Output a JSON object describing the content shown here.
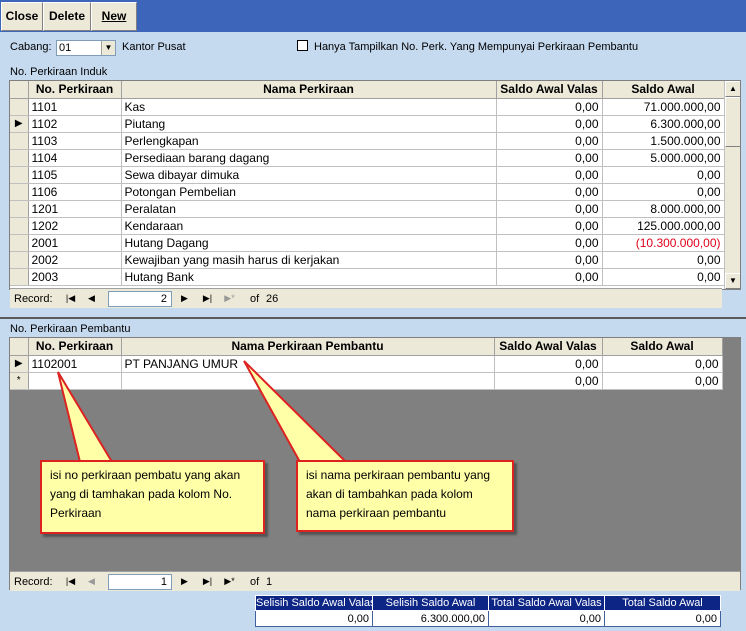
{
  "toolbar": {
    "close_label": "Close",
    "delete_label": "Delete",
    "new_label": "New"
  },
  "filter": {
    "cabang_label": "Cabang:",
    "cabang_value": "01",
    "cabang_name": "Kantor Pusat",
    "checkbox_label": "Hanya Tampilkan No. Perk. Yang Mempunyai Perkiraan Pembantu"
  },
  "induk": {
    "section_label": "No. Perkiraan Induk",
    "headers": [
      "No. Perkiraan",
      "Nama Perkiraan",
      "Saldo Awal Valas",
      "Saldo Awal"
    ],
    "rows": [
      [
        "1101",
        "Kas",
        "0,00",
        "71.000.000,00"
      ],
      [
        "1102",
        "Piutang",
        "0,00",
        "6.300.000,00"
      ],
      [
        "1103",
        "Perlengkapan",
        "0,00",
        "1.500.000,00"
      ],
      [
        "1104",
        "Persediaan barang dagang",
        "0,00",
        "5.000.000,00"
      ],
      [
        "1105",
        "Sewa dibayar dimuka",
        "0,00",
        "0,00"
      ],
      [
        "1106",
        "Potongan Pembelian",
        "0,00",
        "0,00"
      ],
      [
        "1201",
        "Peralatan",
        "0,00",
        "8.000.000,00"
      ],
      [
        "1202",
        "Kendaraan",
        "0,00",
        "125.000.000,00"
      ],
      [
        "2001",
        "Hutang Dagang",
        "0,00",
        "(10.300.000,00)"
      ],
      [
        "2002",
        "Kewajiban yang masih harus di kerjakan",
        "0,00",
        "0,00"
      ],
      [
        "2003",
        "Hutang Bank",
        "0,00",
        "0,00"
      ]
    ],
    "nav": {
      "record_label": "Record:",
      "current": "2",
      "of_label": "of",
      "total": "26"
    }
  },
  "pembantu": {
    "section_label": "No. Perkiraan Pembantu",
    "headers": [
      "No. Perkiraan",
      "Nama Perkiraan Pembantu",
      "Saldo Awal Valas",
      "Saldo Awal"
    ],
    "rows": [
      [
        "1102001",
        "PT PANJANG UMUR",
        "0,00",
        "0,00"
      ]
    ],
    "new_row": [
      "",
      "",
      "0,00",
      "0,00"
    ],
    "nav": {
      "record_label": "Record:",
      "current": "1",
      "of_label": "of",
      "total": "1"
    }
  },
  "callouts": {
    "left": "isi no perkiraan pembatu yang akan  yang di tamhakan pada kolom No. Perkiraan",
    "right": "isi nama perkiraan pembantu yang akan di tambahkan pada kolom nama perkiraan pembantu"
  },
  "totals": {
    "headers": [
      "Selisih Saldo Awal Valas",
      "Selisih Saldo Awal",
      "Total Saldo Awal Valas",
      "Total Saldo Awal"
    ],
    "values": [
      "0,00",
      "6.300.000,00",
      "0,00",
      "0,00"
    ]
  },
  "colors": {
    "toolbar_bg": "#3d66ba",
    "form_bg": "#c5d9ef",
    "negative": "#e0001b",
    "callout_bg": "#ffffa8",
    "callout_border": "#dd2222",
    "totals_header": "#0d2585"
  }
}
